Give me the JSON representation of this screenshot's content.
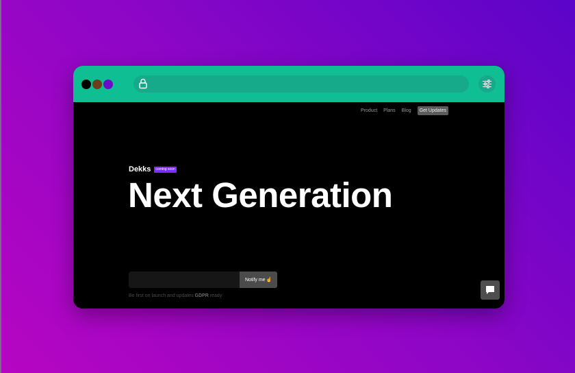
{
  "window": {
    "dots": [
      "#000000",
      "#6b3e1e",
      "#6a0dc9"
    ],
    "titlebar_color": "#0fbf93",
    "address_bar": {
      "icon": "lock-icon",
      "value": ""
    },
    "settings_icon": "sliders-icon"
  },
  "nav": {
    "items": [
      "Product",
      "Plans",
      "Blog"
    ],
    "cta": "Get Updates"
  },
  "hero": {
    "brand": "Dekks",
    "badge": "coming soon",
    "headline": "Next Generation"
  },
  "signup": {
    "email_value": "",
    "button_label": "Notify me",
    "button_icon": "pointing-finger-icon",
    "footnote_prefix": "Be first on launch and updates",
    "footnote_gdpr": "GDPR",
    "footnote_suffix": "ready"
  },
  "chat": {
    "icon": "chat-bubble-icon"
  },
  "colors": {
    "accent": "#0fbf93",
    "badge": "#7b2df5",
    "background_start": "#b606c2",
    "background_end": "#5b04c9"
  }
}
